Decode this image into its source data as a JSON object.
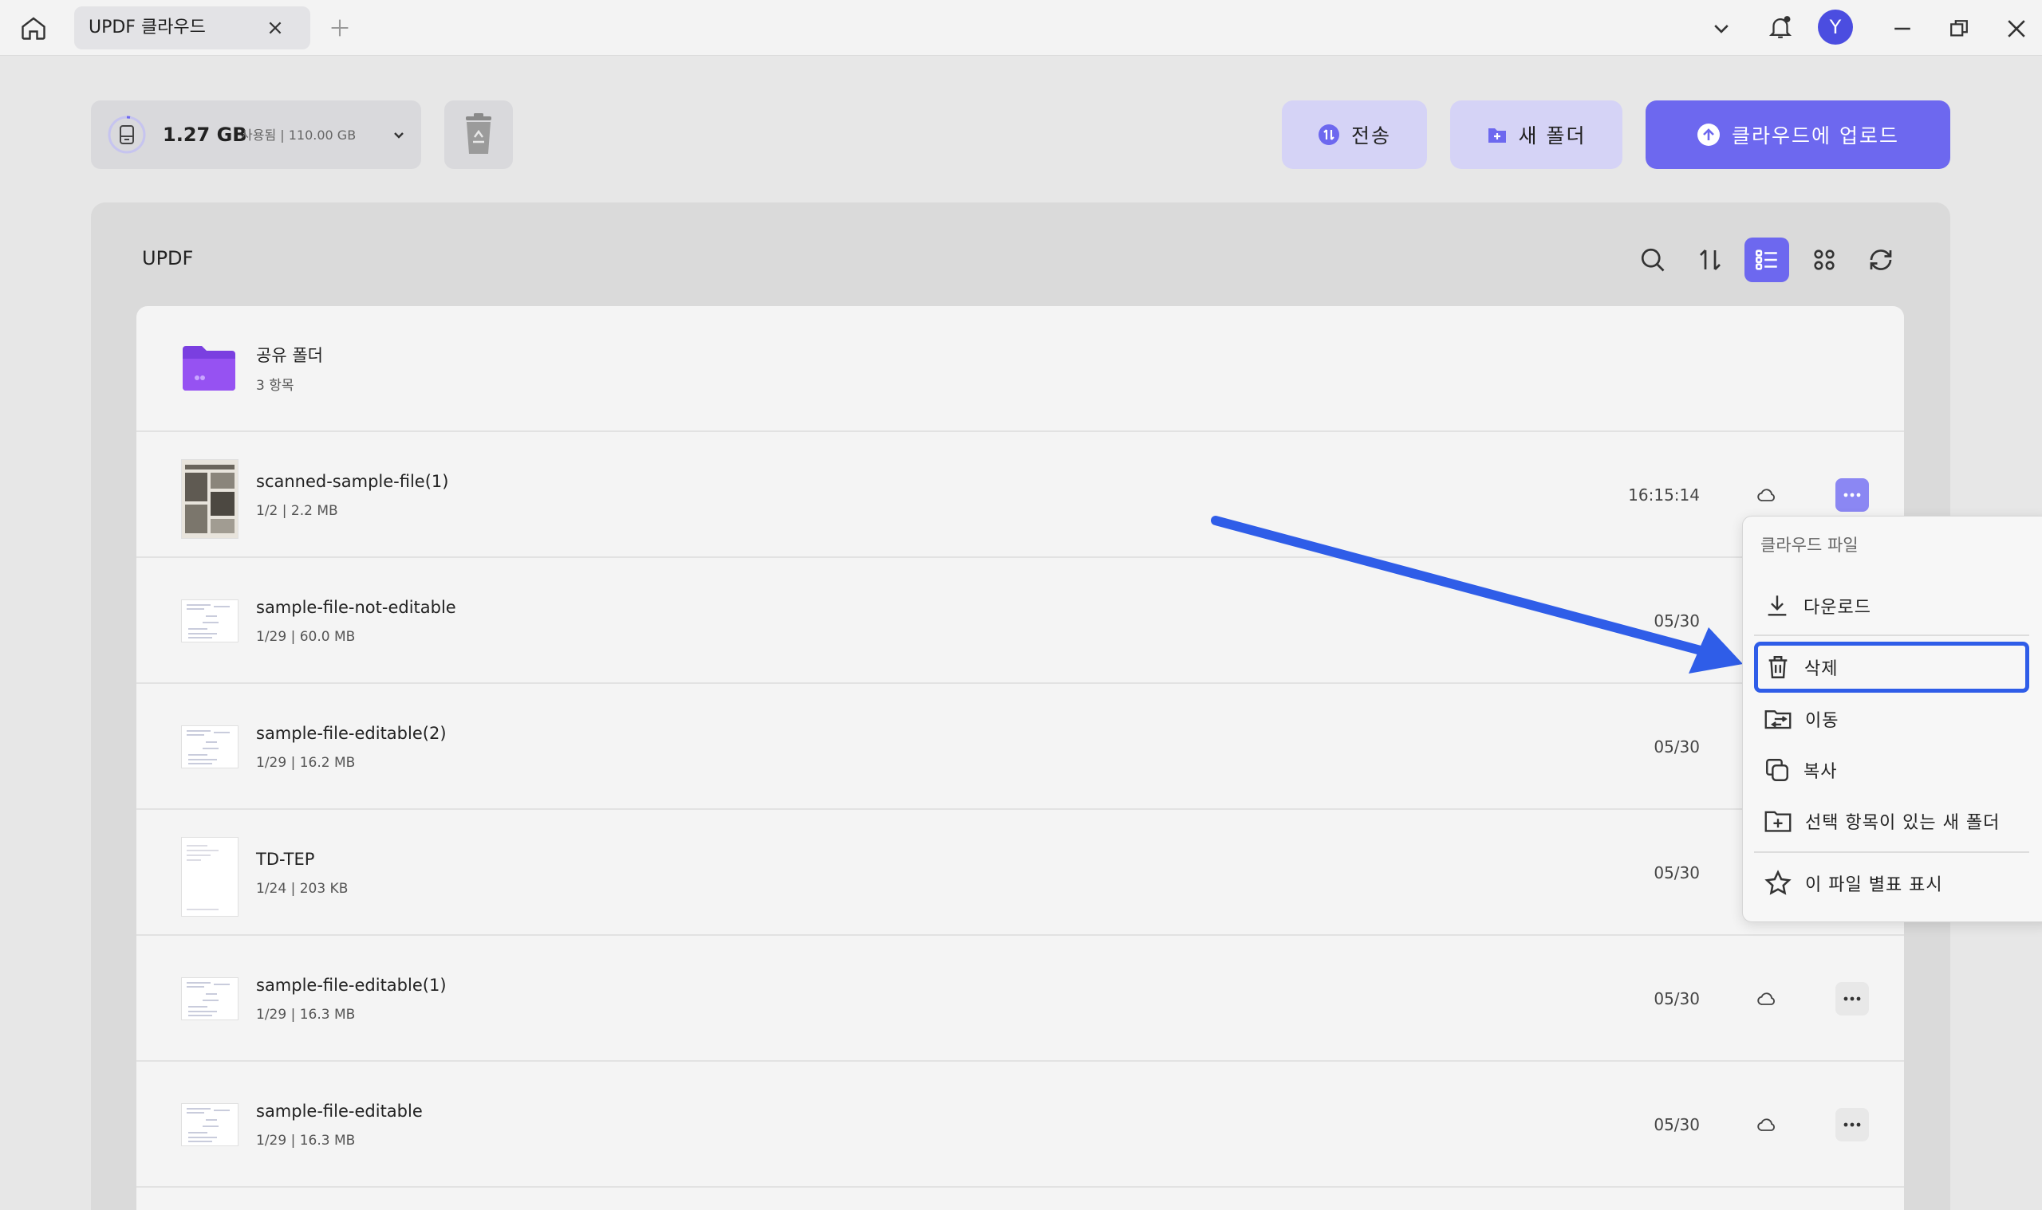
{
  "window": {
    "tab_title": "UPDF 클라우드",
    "avatar_letter": "Y"
  },
  "toolbar": {
    "storage_used": "1.27 GB",
    "storage_detail": "사용됨 | 110.00 GB",
    "transfer_label": "전송",
    "new_folder_label": "새 폴더",
    "upload_label": "클라우드에 업로드"
  },
  "panel": {
    "title": "UPDF"
  },
  "files": [
    {
      "name": "공유 폴더",
      "meta": "3 항목",
      "date": "",
      "type": "folder"
    },
    {
      "name": "scanned-sample-file(1)",
      "meta": "1/2 | 2.2 MB",
      "date": "16:15:14",
      "type": "file"
    },
    {
      "name": "sample-file-not-editable",
      "meta": "1/29 | 60.0 MB",
      "date": "05/30",
      "type": "file"
    },
    {
      "name": "sample-file-editable(2)",
      "meta": "1/29 | 16.2 MB",
      "date": "05/30",
      "type": "file"
    },
    {
      "name": "TD-TEP",
      "meta": "1/24 | 203 KB",
      "date": "05/30",
      "type": "file"
    },
    {
      "name": "sample-file-editable(1)",
      "meta": "1/29 | 16.3 MB",
      "date": "05/30",
      "type": "file"
    },
    {
      "name": "sample-file-editable",
      "meta": "1/29 | 16.3 MB",
      "date": "05/30",
      "type": "file"
    }
  ],
  "context_menu": {
    "header": "클라우드 파일",
    "items": [
      {
        "label": "다운로드",
        "icon": "download-icon"
      },
      {
        "label": "삭제",
        "icon": "trash-icon"
      },
      {
        "label": "이동",
        "icon": "move-folder-icon"
      },
      {
        "label": "복사",
        "icon": "copy-icon"
      },
      {
        "label": "선택 항목이 있는 새 폴더",
        "icon": "new-folder-icon"
      },
      {
        "label": "이 파일 별표 표시",
        "icon": "star-icon"
      }
    ]
  },
  "colors": {
    "accent": "#6d68ef",
    "accent_light": "#d5d3f6",
    "highlight": "#2f5de8"
  }
}
